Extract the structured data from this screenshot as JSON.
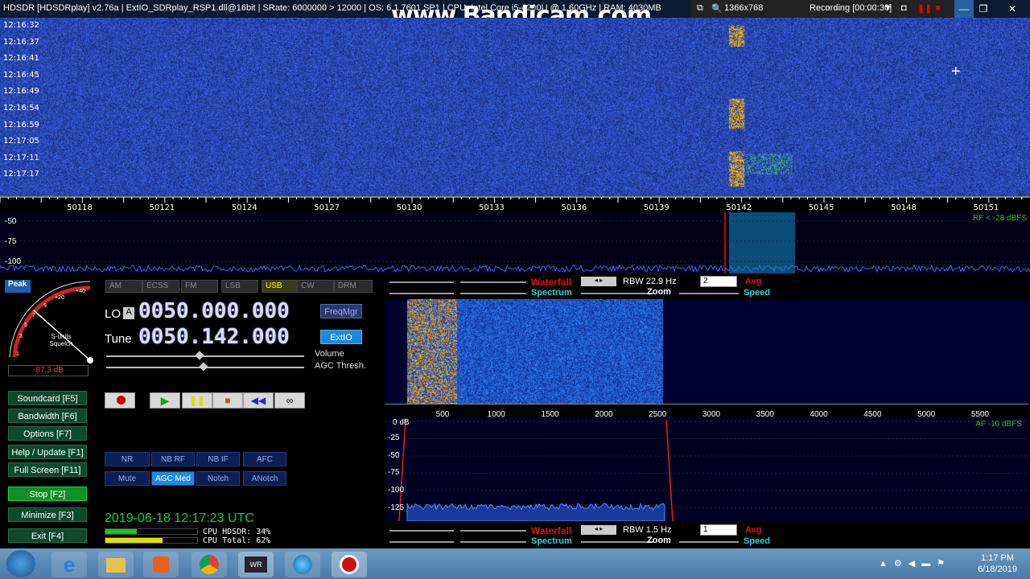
{
  "window": {
    "title": "HDSDR  [HDSDRplay]  v2.76a   |  ExtIO_SDRplay_RSP1.dll@16bit   |  SRate: 6000000 > 12000   |  OS: 6.1.7601 SP1  |  CPU: Intel Core i5-4200U @ 1.60GHz   |  RAM: 4030MB",
    "watermark": "www.Bandicam.com",
    "resolution": "1366x768",
    "recording": "Recording [00:00:30]"
  },
  "waterfall": {
    "times": [
      "12:16:32",
      "12:16:37",
      "12:16:41",
      "12:16:45",
      "12:16:49",
      "12:16:54",
      "12:16:59",
      "12:17:05",
      "12:17:11",
      "12:17:17"
    ],
    "freq_ticks": [
      "50118",
      "50121",
      "50124",
      "50127",
      "50130",
      "50133",
      "50136",
      "50139",
      "50142",
      "50145",
      "50148",
      "50151"
    ]
  },
  "spectrum": {
    "db_labels": [
      "-50",
      "-75",
      "-100"
    ],
    "rf_label": "RF < -28 dBFS"
  },
  "modes": [
    "AM",
    "ECSS",
    "FM",
    "LSB",
    "USB",
    "CW",
    "DRM"
  ],
  "active_mode": "USB",
  "lo": {
    "label": "LO",
    "flag": "A",
    "value": "0050.000.000"
  },
  "tune": {
    "label": "Tune",
    "value": "0050.142.000"
  },
  "freqmgr": "FreqMgr",
  "extio": "ExtIO",
  "volume": "Volume",
  "agc_thresh": "AGC Thresh.",
  "smeter": {
    "peak": "Peak",
    "value": "-87.3 dB",
    "squelch": "S-units Squelch"
  },
  "left_buttons": [
    {
      "label": "Soundcard  [F5]"
    },
    {
      "label": "Bandwidth  [F6]"
    },
    {
      "label": "Options     [F7]"
    },
    {
      "label": "Help / Update  [F1]"
    },
    {
      "label": "Full Screen  [F11]"
    },
    {
      "label": "Stop       [F2]"
    },
    {
      "label": "Minimize  [F3]"
    },
    {
      "label": "Exit       [F4]"
    }
  ],
  "dsp_buttons": [
    "NR",
    "NB RF",
    "NB IF",
    "AFC"
  ],
  "dsp_buttons2": [
    "Mute",
    "AGC Med",
    "Notch",
    "ANotch"
  ],
  "status": {
    "datetime": "2019-06-18   12:17:23 UTC",
    "cpu_hdsdr": "CPU HDSDR:  34%",
    "cpu_total": "CPU Total:  62%"
  },
  "top_controls": {
    "waterfall": "Waterfall",
    "spectrum": "Spectrum",
    "rbw": "RBW  22.9 Hz",
    "sel": "2",
    "zoom": "Zoom",
    "avg": "Avg",
    "speed": "Speed"
  },
  "bottom_controls": {
    "waterfall": "Waterfall",
    "spectrum": "Spectrum",
    "rbw": "RBW   1.5 Hz",
    "sel": "1",
    "zoom": "Zoom",
    "avg": "Avg",
    "speed": "Speed"
  },
  "audio": {
    "freq_ticks": [
      "500",
      "1000",
      "1500",
      "2000",
      "2500",
      "3000",
      "3500",
      "4000",
      "4500",
      "5000",
      "5500"
    ],
    "db_labels": [
      "0 dB",
      "-25",
      "-50",
      "-75",
      "-100",
      "-125"
    ],
    "af_label": "AF -10 dBFS"
  },
  "taskbar": {
    "time": "1:17 PM",
    "date": "6/18/2019"
  }
}
